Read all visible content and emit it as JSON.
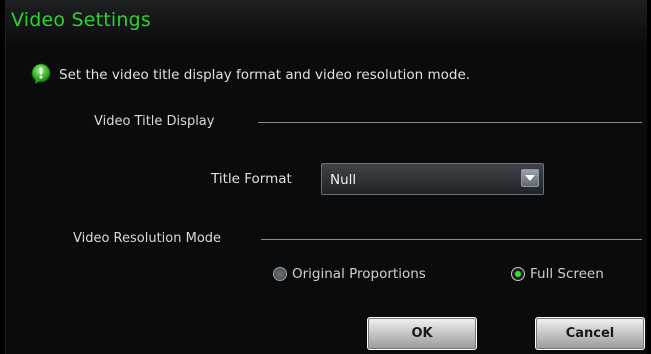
{
  "dialog": {
    "title": "Video Settings",
    "info_text": "Set the video title display format and video resolution mode.",
    "title_section": {
      "label": "Video Title Display",
      "title_format_label": "Title Format",
      "title_format_value": "Null"
    },
    "resolution_section": {
      "label": "Video Resolution Mode",
      "options": [
        {
          "label": "Original Proportions",
          "checked": false
        },
        {
          "label": "Full Screen",
          "checked": true
        }
      ]
    },
    "buttons": {
      "ok_label": "OK",
      "cancel_label": "Cancel"
    }
  },
  "icons": {
    "info": "info-bubble-icon",
    "dropdown": "chevron-down-icon",
    "radio": "radio-icon"
  },
  "colors": {
    "title": "#2ed22e",
    "radio_checked": "#33e033",
    "background": "#0a0b0c"
  }
}
